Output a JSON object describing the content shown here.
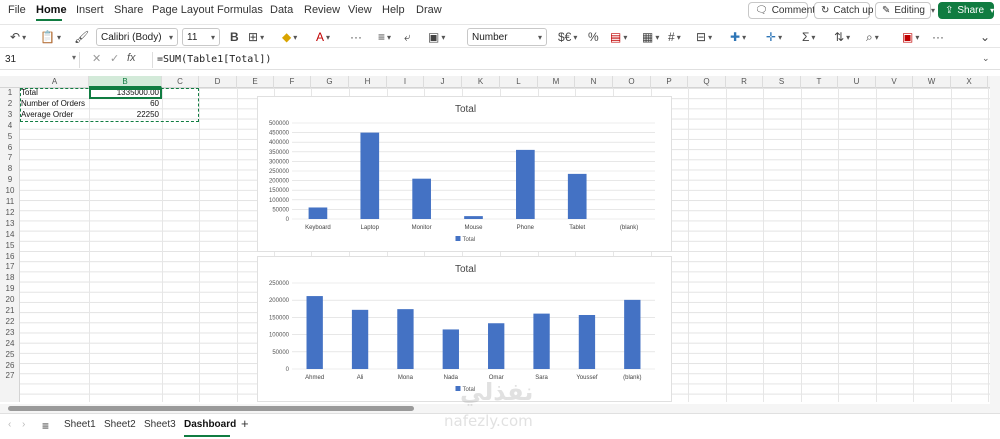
{
  "menu": {
    "items": [
      "File",
      "Home",
      "Insert",
      "Share",
      "Page Layout",
      "Formulas",
      "Data",
      "Review",
      "View",
      "Help",
      "Draw"
    ],
    "active": "Home",
    "comments_label": "Comments",
    "catchup_label": "Catch up",
    "editing_label": "Editing",
    "share_label": "Share"
  },
  "ribbon": {
    "font_name": "Calibri (Body)",
    "font_size": "11",
    "bold_label": "B",
    "number_format": "Number",
    "more": "···"
  },
  "formula_bar": {
    "name_box": "31",
    "fx_label": "fx",
    "formula": "=SUM(Table1[Total])"
  },
  "columns": [
    "A",
    "B",
    "C",
    "D",
    "E",
    "F",
    "G",
    "H",
    "I",
    "J",
    "K",
    "L",
    "M",
    "N",
    "O",
    "P",
    "Q",
    "R",
    "S",
    "T",
    "U",
    "V",
    "W",
    "X"
  ],
  "selected_column": "B",
  "rows": [
    "1",
    "2",
    "3",
    "4",
    "5",
    "6",
    "7",
    "8",
    "9",
    "10",
    "11",
    "12",
    "13",
    "14",
    "15",
    "16",
    "17",
    "18",
    "19",
    "20",
    "21",
    "22",
    "23",
    "24",
    "25",
    "26",
    "27"
  ],
  "cells": {
    "a1": "Total",
    "b1": "1335000.00",
    "a2": "Number of Orders",
    "b2": "60",
    "a3": "Average Order",
    "b3": "22250"
  },
  "chart_data": [
    {
      "type": "bar",
      "title": "Total",
      "categories": [
        "Keyboard",
        "Laptop",
        "Monitor",
        "Mouse",
        "Phone",
        "Tablet",
        "(blank)"
      ],
      "series": [
        {
          "name": "Total",
          "values": [
            60000,
            450000,
            210000,
            15000,
            360000,
            235000,
            0
          ]
        }
      ],
      "ylim": [
        0,
        500000
      ],
      "yticks": [
        "0",
        "50000",
        "100000",
        "150000",
        "200000",
        "250000",
        "300000",
        "350000",
        "400000",
        "450000",
        "500000"
      ],
      "grid": true,
      "legend": "bottom",
      "color": "#4472c4"
    },
    {
      "type": "bar",
      "title": "Total",
      "categories": [
        "Ahmed",
        "Ali",
        "Mona",
        "Nada",
        "Omar",
        "Sara",
        "Youssef",
        "(blank)"
      ],
      "series": [
        {
          "name": "Total",
          "values": [
            212000,
            172000,
            174000,
            115000,
            133000,
            161000,
            157000,
            201000
          ]
        }
      ],
      "ylim": [
        0,
        250000
      ],
      "yticks": [
        "0",
        "50000",
        "100000",
        "150000",
        "200000",
        "250000"
      ],
      "grid": true,
      "legend": "bottom",
      "color": "#4472c4"
    }
  ],
  "sheet_tabs": [
    "Sheet1",
    "Sheet2",
    "Sheet3",
    "Dashboard"
  ],
  "active_sheet": "Dashboard",
  "add_sheet": "+",
  "watermark": {
    "arabic": "نفذلي",
    "url": "nafezly.com"
  }
}
